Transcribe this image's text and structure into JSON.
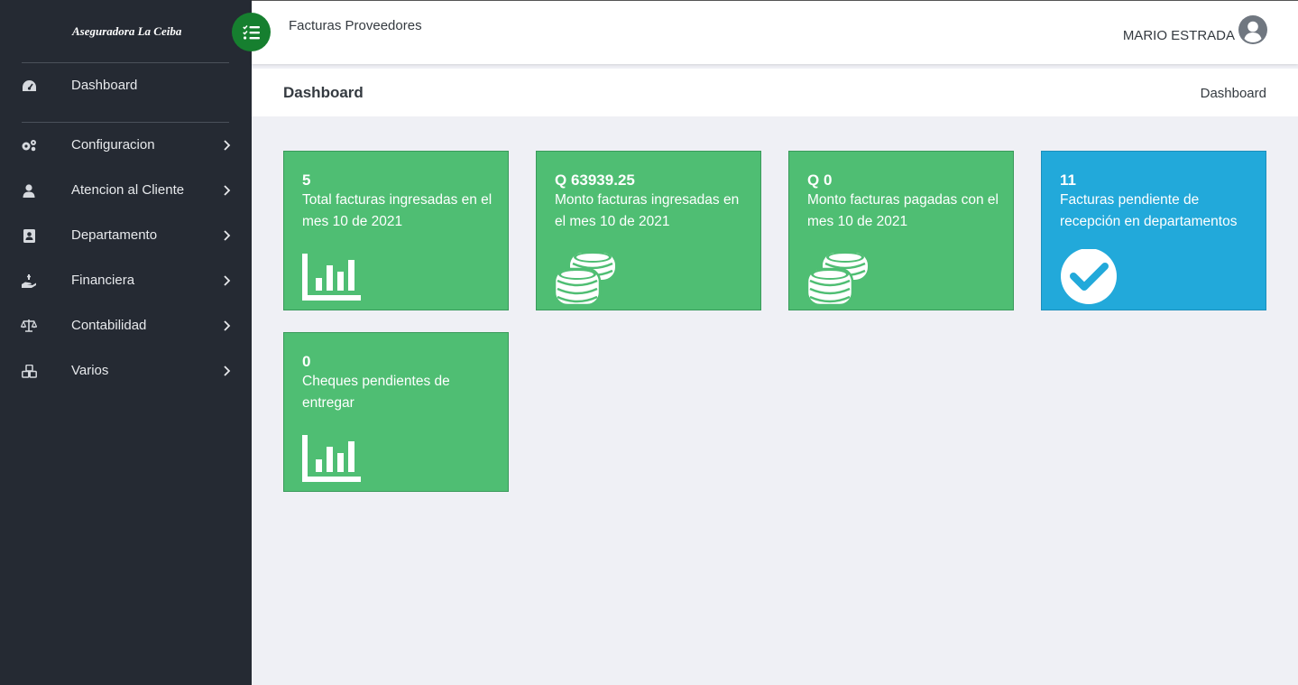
{
  "sidebar": {
    "brand": "Aseguradora La Ceiba",
    "items": [
      {
        "label": "Dashboard",
        "icon": "tachometer-icon",
        "has_submenu": false
      },
      {
        "label": "Configuracion",
        "icon": "gears-icon",
        "has_submenu": true
      },
      {
        "label": "Atencion al Cliente",
        "icon": "user-icon",
        "has_submenu": true
      },
      {
        "label": "Departamento",
        "icon": "contact-card-icon",
        "has_submenu": true
      },
      {
        "label": "Financiera",
        "icon": "hand-money-icon",
        "has_submenu": true
      },
      {
        "label": "Contabilidad",
        "icon": "scale-icon",
        "has_submenu": true
      },
      {
        "label": "Varios",
        "icon": "cubes-icon",
        "has_submenu": true
      }
    ]
  },
  "topbar": {
    "app_title": "Facturas Proveedores",
    "user_name": "MARIO ESTRADA",
    "toggle_icon": "list-check-icon"
  },
  "page": {
    "title": "Dashboard",
    "breadcrumb": "Dashboard"
  },
  "cards": [
    {
      "value": "5",
      "description": "Total facturas ingresadas en el mes 10 de 2021",
      "icon": "bar-chart-icon",
      "color": "#4fbe73"
    },
    {
      "value": "Q 63939.25",
      "description": "Monto facturas ingresadas en el mes 10 de 2021",
      "icon": "coins-icon",
      "color": "#4fbe73"
    },
    {
      "value": "Q 0",
      "description": "Monto facturas pagadas con el mes 10 de 2021",
      "icon": "coins-icon",
      "color": "#4fbe73"
    },
    {
      "value": "11",
      "description": "Facturas pendiente de recepción en departamentos",
      "icon": "check-circle-icon",
      "color": "#22a9da"
    },
    {
      "value": "0",
      "description": "Cheques pendientes de entregar",
      "icon": "bar-chart-icon",
      "color": "#4fbe73"
    }
  ],
  "colors": {
    "sidebar_bg": "#252a33",
    "content_bg": "#eff0f5",
    "card_green": "#4fbe73",
    "card_blue": "#22a9da",
    "toggle_green": "#167f2f"
  }
}
